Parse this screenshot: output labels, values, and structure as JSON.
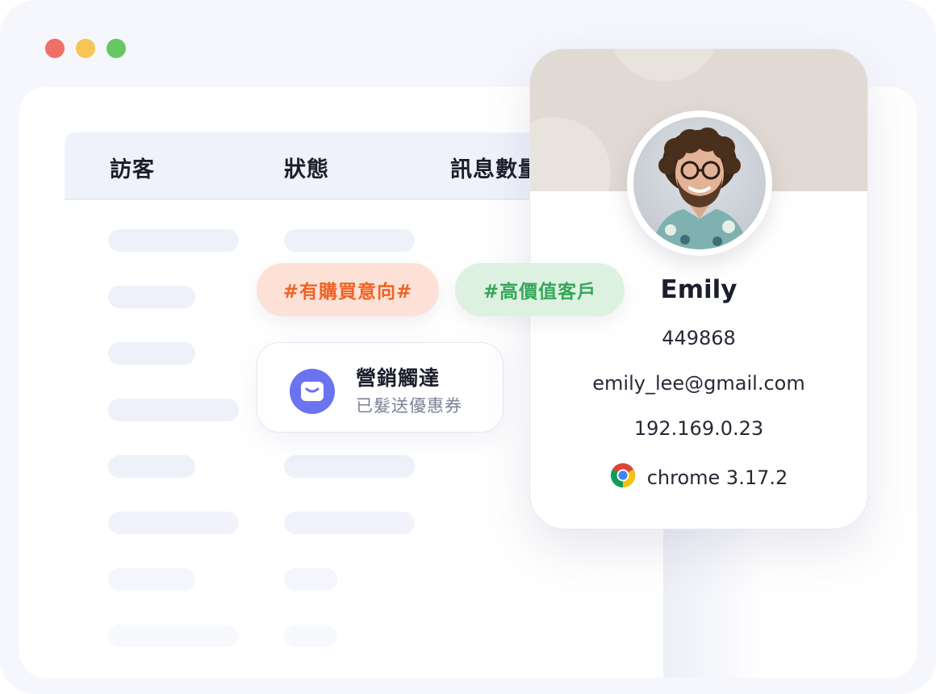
{
  "window": {
    "traffic_lights": [
      {
        "name": "close",
        "color": "#ee6f66"
      },
      {
        "name": "minimize",
        "color": "#f6c556"
      },
      {
        "name": "maximize",
        "color": "#66c763"
      }
    ]
  },
  "table": {
    "columns": [
      "訪客",
      "狀態",
      "訊息數量"
    ]
  },
  "tags": {
    "purchase_intent": "#有購買意向#",
    "high_value": "#高價值客戶"
  },
  "notice": {
    "icon": "mail-icon",
    "title": "營銷觸達",
    "subtitle": "已髮送優惠券"
  },
  "profile": {
    "name": "Emily",
    "id": "449868",
    "email": "emily_lee@gmail.com",
    "ip": "192.169.0.23",
    "browser_icon": "chrome-icon",
    "browser": "chrome 3.17.2"
  },
  "colors": {
    "accent": "#6b73ee",
    "tag_orange_bg": "#fde1d6",
    "tag_orange_text": "#f06324",
    "tag_green_bg": "#ddf1e1",
    "tag_green_text": "#36a659"
  }
}
